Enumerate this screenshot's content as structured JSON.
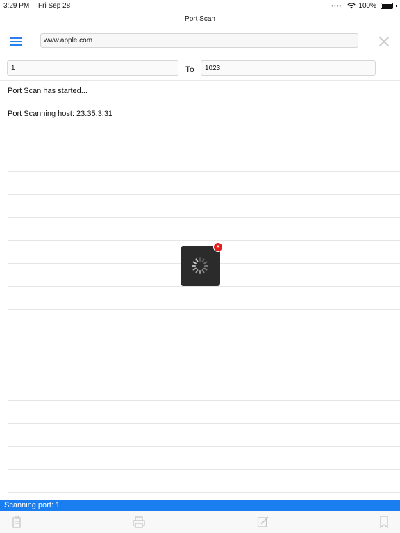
{
  "status_bar": {
    "time": "3:29 PM",
    "date": "Fri Sep 28",
    "battery": "100%"
  },
  "nav": {
    "title": "Port Scan"
  },
  "host_input": {
    "value": "www.apple.com"
  },
  "range": {
    "start_port": "1",
    "to_label": "To",
    "end_port": "1023"
  },
  "log": {
    "lines": [
      "Port Scan has started...",
      "Port Scanning host: 23.35.3.31",
      "",
      "",
      "",
      "",
      "",
      "",
      "",
      "",
      "",
      "",
      "",
      "",
      "",
      "",
      "",
      "",
      ""
    ]
  },
  "progress": {
    "text": "Scanning port: 1"
  },
  "toolbar": {
    "icons": [
      "clipboard-icon",
      "print-icon",
      "edit-icon",
      "bookmark-icon"
    ]
  },
  "colors": {
    "accent": "#2c7ff0",
    "progress_bar": "#1a7ef0",
    "overlay": "#2b2b2b",
    "cancel": "#e31c1c"
  }
}
